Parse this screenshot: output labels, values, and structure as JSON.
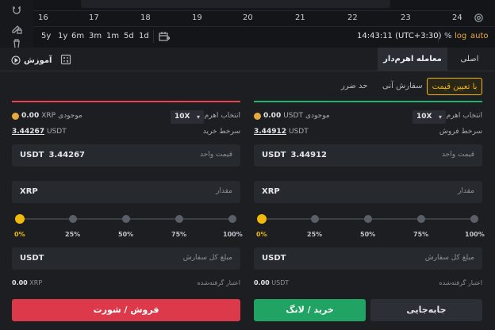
{
  "chart": {
    "dates": [
      "16",
      "17",
      "18",
      "19",
      "20",
      "21",
      "22",
      "23",
      "24"
    ],
    "timeframes": [
      "5y",
      "1y",
      "6m",
      "3m",
      "1m",
      "5d",
      "1d"
    ],
    "clock": "14:43:11 (UTC+3:30)",
    "options": {
      "percent": "%",
      "log": "log",
      "auto": "auto"
    }
  },
  "tabs": {
    "spot": "اصلی",
    "margin": "معامله اهرم‌دار",
    "learn": "آموزش"
  },
  "order_types": {
    "limit": "با تعیین قیمت",
    "market": "سفارش آنی",
    "stop": "حد ضرر"
  },
  "buy": {
    "balance_label": "موجودی",
    "balance_value": "0.00",
    "balance_unit": "USDT",
    "leverage_value": "10X",
    "leverage_label": "انتخاب اهرم",
    "price_value": "3.44912",
    "price_unit": "USDT",
    "price_label": "سرخط فروش",
    "unit_price_currency": "USDT",
    "unit_price_value": "3.44912",
    "unit_price_label": "قیمت واحد",
    "amount_currency": "XRP",
    "amount_label": "مقدار",
    "slider_labels": [
      "0%",
      "25%",
      "50%",
      "75%",
      "100%"
    ],
    "slider_value_percent": 0,
    "total_currency": "USDT",
    "total_label": "مبلغ کل سفارش",
    "credit_value": "0.00",
    "credit_unit": "USDT",
    "credit_label": "اعتبار گرفته‌شده",
    "submit_label": "خرید / لانگ"
  },
  "sell": {
    "balance_label": "موجودی",
    "balance_value": "0.00",
    "balance_unit": "XRP",
    "leverage_value": "10X",
    "leverage_label": "انتخاب اهرم",
    "price_value": "3.44267",
    "price_unit": "USDT",
    "price_label": "سرخط خرید",
    "unit_price_currency": "USDT",
    "unit_price_value": "3.44267",
    "unit_price_label": "قیمت واحد",
    "amount_currency": "XRP",
    "amount_label": "مقدار",
    "slider_labels": [
      "0%",
      "25%",
      "50%",
      "75%",
      "100%"
    ],
    "slider_value_percent": 0,
    "total_currency": "USDT",
    "total_label": "مبلغ کل سفارش",
    "credit_value": "0.00",
    "credit_unit": "XRP",
    "credit_label": "اعتبار گرفته‌شده",
    "submit_label": "فروش / شورت"
  },
  "transfer_label": "جابه‌جایی",
  "colors": {
    "buy": "#21a363",
    "sell": "#dc3a4b",
    "accent": "#f0b90b"
  }
}
